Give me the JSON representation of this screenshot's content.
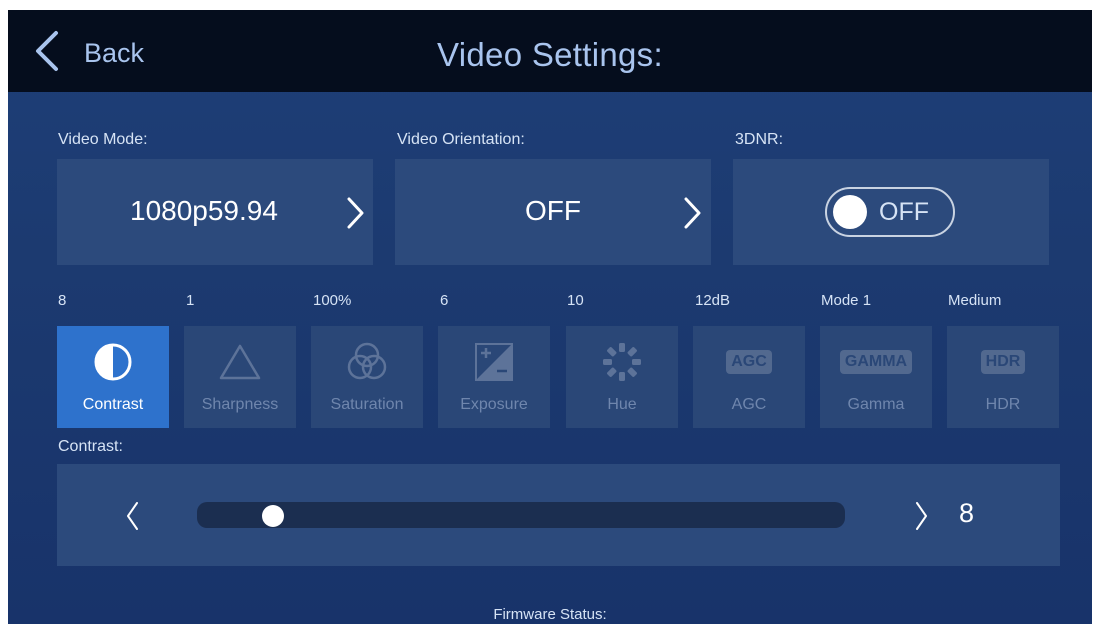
{
  "header": {
    "back_label": "Back",
    "title": "Video Settings:"
  },
  "video_mode": {
    "label": "Video Mode:",
    "value": "1080p59.94"
  },
  "video_orientation": {
    "label": "Video Orientation:",
    "value": "OFF"
  },
  "dnr": {
    "label": "3DNR:",
    "state": "OFF"
  },
  "params": [
    {
      "name": "Contrast",
      "value": "8",
      "icon": "contrast-icon",
      "active": true
    },
    {
      "name": "Sharpness",
      "value": "1",
      "icon": "sharpness-icon",
      "active": false
    },
    {
      "name": "Saturation",
      "value": "100%",
      "icon": "saturation-icon",
      "active": false
    },
    {
      "name": "Exposure",
      "value": "6",
      "icon": "exposure-icon",
      "active": false
    },
    {
      "name": "Hue",
      "value": "10",
      "icon": "hue-icon",
      "active": false
    },
    {
      "name": "AGC",
      "value": "12dB",
      "icon": "agc-icon",
      "badge": "AGC",
      "active": false
    },
    {
      "name": "Gamma",
      "value": "Mode 1",
      "icon": "gamma-icon",
      "badge": "GAMMA",
      "active": false
    },
    {
      "name": "HDR",
      "value": "Medium",
      "icon": "hdr-icon",
      "badge": "HDR",
      "active": false
    }
  ],
  "slider": {
    "label": "Contrast:",
    "value": "8",
    "fraction": 0.1
  },
  "footer": {
    "firmware_label": "Firmware Status:"
  },
  "colors": {
    "background": "#1c3a70",
    "topbar": "#050d1d",
    "card": "#2c4a7c",
    "active_tile": "#2e72cc",
    "accent_text": "#a9c4ee"
  }
}
